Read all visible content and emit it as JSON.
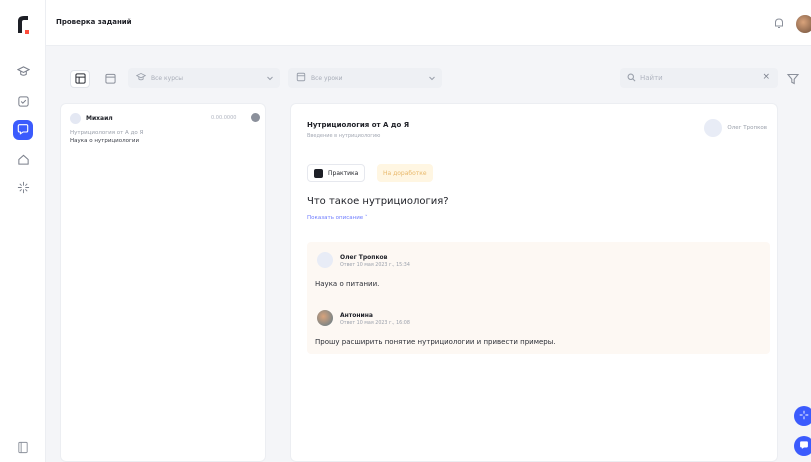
{
  "header": {
    "title": "Проверка заданий"
  },
  "filters": {
    "course_placeholder": "Все курсы",
    "lesson_placeholder": "Все уроки",
    "search_placeholder": "Найти"
  },
  "list": {
    "items": [
      {
        "name": "Михаил",
        "date": "0.00.0000",
        "course": "Нутрициология от А до Я",
        "task": "Наука о нутрициологии"
      }
    ]
  },
  "detail": {
    "course_title": "Нутрициология от А до Я",
    "lesson_title": "Введение в нутрициологию",
    "reviewer": "Олег Тропков",
    "tag_practice": "Практика",
    "tag_status": "На доработке",
    "question": "Что такое нутрициология?",
    "show_description": "Показать описание ˅",
    "messages": [
      {
        "author": "Олег Тропков",
        "meta": "Ответ 10 мая 2023 г., 15:34",
        "text": "Наука о питании."
      },
      {
        "author": "Антонина",
        "meta": "Ответ 10 мая 2023 г., 16:08",
        "text": "Прошу расширить понятие нутрициологии и привести примеры."
      }
    ]
  },
  "colors": {
    "accent": "#3b5bfd",
    "status_bg": "#fff6e2",
    "status_text": "#e8b86a",
    "thread_bg": "#fdf8f3"
  },
  "icons": {
    "rail": [
      "graduation-cap-icon",
      "clipboard-check-icon",
      "chat-bubble-icon",
      "home-icon",
      "sparkle-icon",
      "book-icon"
    ],
    "top": [
      "bell-icon",
      "avatar"
    ],
    "filters": [
      "layout-table-icon",
      "calendar-icon",
      "graduation-cap-icon",
      "lesson-icon",
      "search-icon",
      "close-icon",
      "filter-icon"
    ],
    "fab": [
      "sparkle-icon",
      "chat-icon"
    ]
  }
}
